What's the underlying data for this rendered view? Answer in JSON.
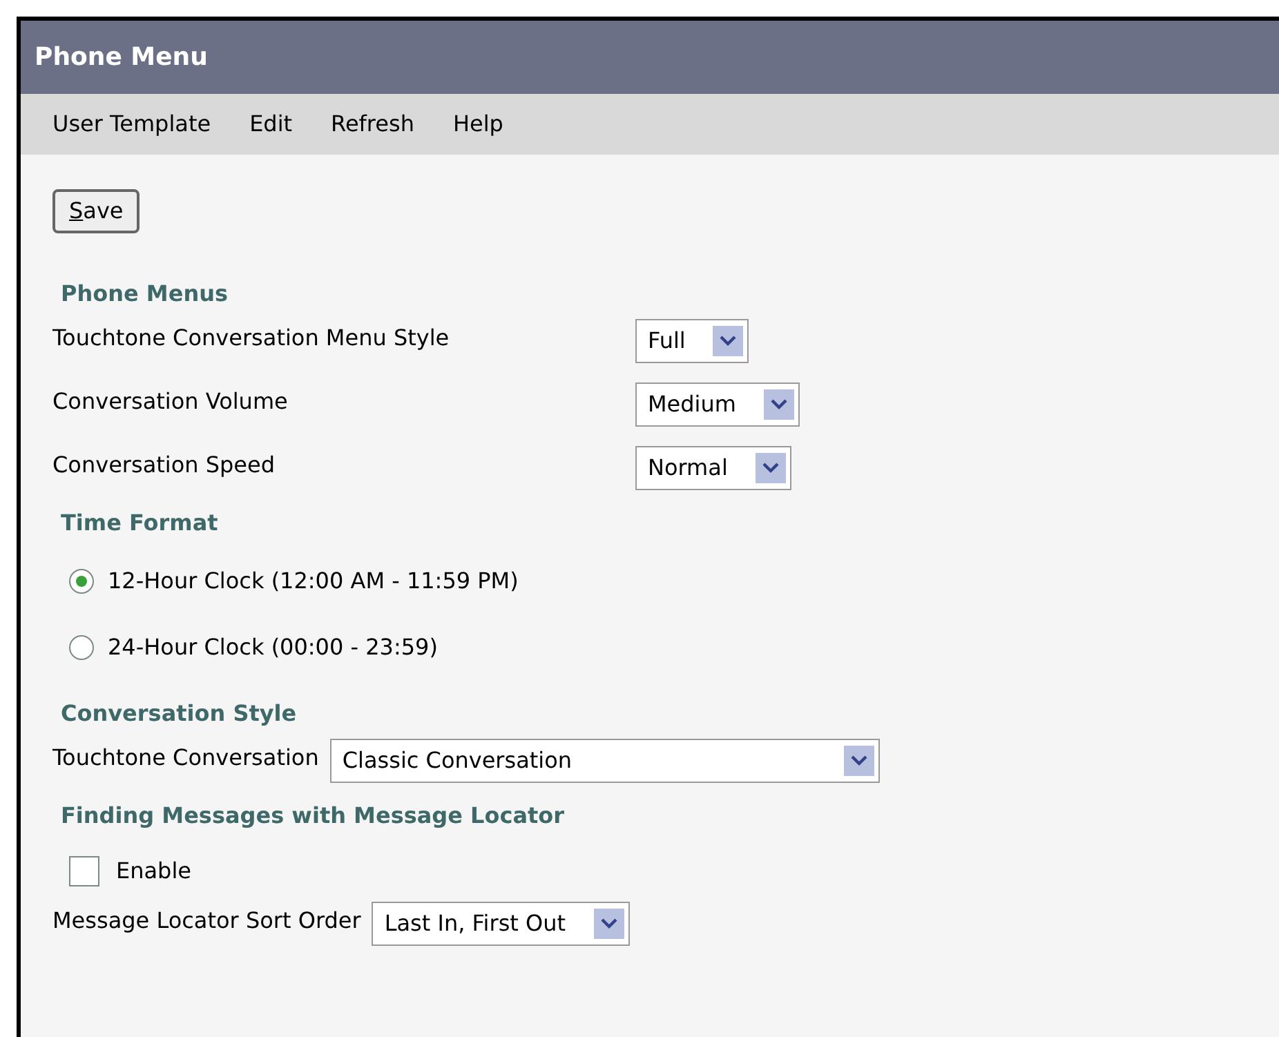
{
  "window": {
    "title": "Phone Menu"
  },
  "menu": [
    "User Template",
    "Edit",
    "Refresh",
    "Help"
  ],
  "save_button": "Save",
  "sections": [
    {
      "heading": "Phone Menus",
      "kind": "aligned",
      "items": [
        {
          "kind": "select",
          "label": "Touchtone Conversation Menu Style",
          "value": "Full"
        },
        {
          "kind": "select",
          "label": "Conversation Volume",
          "value": "Medium"
        },
        {
          "kind": "select",
          "label": "Conversation Speed",
          "value": "Normal"
        }
      ]
    },
    {
      "heading": "Time Format",
      "kind": "inline",
      "items": [
        {
          "kind": "radio",
          "label": "12-Hour Clock (12:00 AM - 11:59 PM)",
          "selected": true
        },
        {
          "kind": "radio",
          "label": "24-Hour Clock (00:00 - 23:59)",
          "selected": false
        }
      ]
    },
    {
      "heading": "Conversation Style",
      "kind": "inline",
      "items": [
        {
          "kind": "select",
          "label": "Touchtone Conversation",
          "value": "Classic Conversation"
        }
      ]
    },
    {
      "heading": "Finding Messages with Message Locator",
      "kind": "inline",
      "items": [
        {
          "kind": "checkbox",
          "label": "Enable",
          "checked": false
        },
        {
          "kind": "select",
          "label": "Message Locator Sort Order",
          "value": "Last In, First Out"
        }
      ]
    }
  ]
}
